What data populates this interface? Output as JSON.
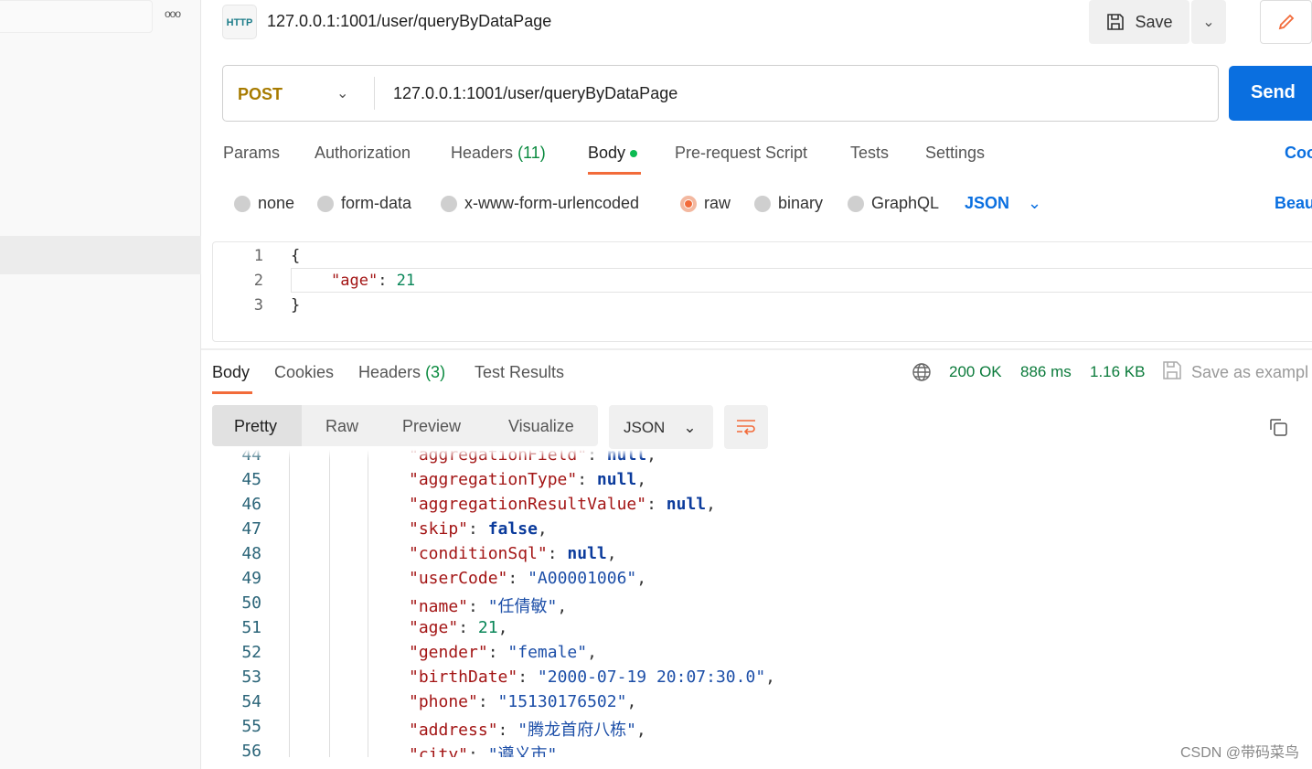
{
  "sidebar": {
    "more_icon": "ooo"
  },
  "header": {
    "icon_label": "HTTP",
    "title": "127.0.0.1:1001/user/queryByDataPage",
    "save_label": "Save"
  },
  "request": {
    "method": "POST",
    "url": "127.0.0.1:1001/user/queryByDataPage",
    "send_label": "Send",
    "tabs": [
      {
        "label": "Params"
      },
      {
        "label": "Authorization"
      },
      {
        "label": "Headers",
        "count": "(11)"
      },
      {
        "label": "Body"
      },
      {
        "label": "Pre-request Script"
      },
      {
        "label": "Tests"
      },
      {
        "label": "Settings"
      }
    ],
    "cookies_link": "Coo",
    "body_types": [
      "none",
      "form-data",
      "x-www-form-urlencoded",
      "raw",
      "binary",
      "GraphQL"
    ],
    "selected_body_type": "raw",
    "language": "JSON",
    "beautify": "Beau",
    "body_lines": [
      {
        "n": "1",
        "text": "{"
      },
      {
        "n": "2",
        "key": "\"age\"",
        "value": "21"
      },
      {
        "n": "3",
        "text": "}"
      }
    ]
  },
  "response": {
    "tabs": [
      {
        "label": "Body"
      },
      {
        "label": "Cookies"
      },
      {
        "label": "Headers",
        "count": "(3)"
      },
      {
        "label": "Test Results"
      }
    ],
    "status": "200 OK",
    "time": "886 ms",
    "size": "1.16 KB",
    "save_example": "Save as exampl",
    "views": [
      "Pretty",
      "Raw",
      "Preview",
      "Visualize"
    ],
    "format": "JSON",
    "lines": [
      {
        "n": "44",
        "k": "\"aggregationField\"",
        "v": "null",
        "type": "kw"
      },
      {
        "n": "45",
        "k": "\"aggregationType\"",
        "v": "null",
        "type": "kw"
      },
      {
        "n": "46",
        "k": "\"aggregationResultValue\"",
        "v": "null",
        "type": "kw"
      },
      {
        "n": "47",
        "k": "\"skip\"",
        "v": "false",
        "type": "kw"
      },
      {
        "n": "48",
        "k": "\"conditionSql\"",
        "v": "null",
        "type": "kw"
      },
      {
        "n": "49",
        "k": "\"userCode\"",
        "v": "\"A00001006\"",
        "type": "s"
      },
      {
        "n": "50",
        "k": "\"name\"",
        "v": "\"任倩敏\"",
        "type": "s"
      },
      {
        "n": "51",
        "k": "\"age\"",
        "v": "21",
        "type": "num"
      },
      {
        "n": "52",
        "k": "\"gender\"",
        "v": "\"female\"",
        "type": "s"
      },
      {
        "n": "53",
        "k": "\"birthDate\"",
        "v": "\"2000-07-19 20:07:30.0\"",
        "type": "s"
      },
      {
        "n": "54",
        "k": "\"phone\"",
        "v": "\"15130176502\"",
        "type": "s"
      },
      {
        "n": "55",
        "k": "\"address\"",
        "v": "\"腾龙首府八栋\"",
        "type": "s"
      },
      {
        "n": "56",
        "k": "\"city\"",
        "v": "\"遵义市\"",
        "type": "s"
      }
    ]
  },
  "watermark": "CSDN @带码菜鸟",
  "colors": {
    "accent": "#f26b3a",
    "send": "#0a6fe0",
    "method": "#a77b00",
    "status": "#0a7a3a"
  }
}
